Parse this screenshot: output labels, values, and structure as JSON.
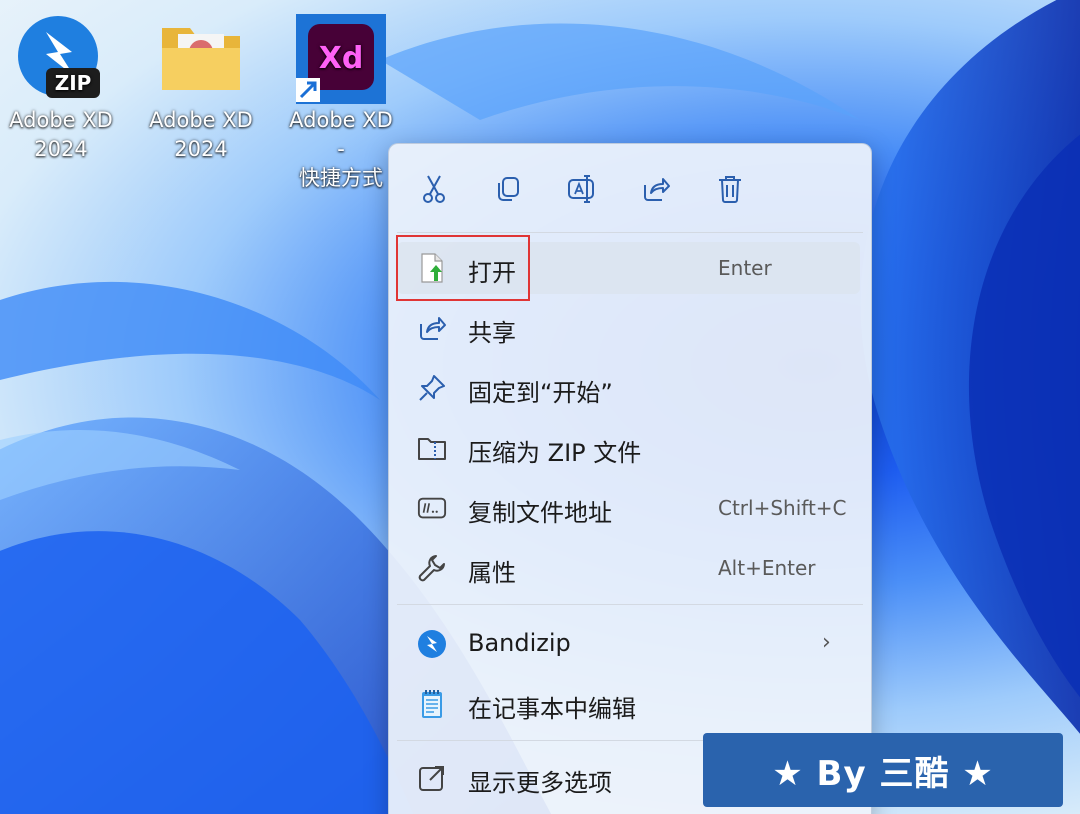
{
  "desktop": {
    "icons": [
      {
        "label_line1": "Adobe XD",
        "label_line2": "2024",
        "icon": "zip-archive-icon",
        "badge_text": "ZIP"
      },
      {
        "label_line1": "Adobe XD",
        "label_line2": "2024",
        "icon": "folder-icon"
      },
      {
        "label_line1": "Adobe XD -",
        "label_line2": "快捷方式",
        "icon": "adobe-xd-app-icon",
        "badge_text": "Xd"
      }
    ]
  },
  "context_menu": {
    "toolbar": [
      "cut-icon",
      "copy-icon",
      "rename-icon",
      "share-icon",
      "delete-icon"
    ],
    "items": [
      {
        "label": "打开",
        "shortcut": "Enter",
        "icon": "open-file-icon"
      },
      {
        "label": "共享",
        "shortcut": "",
        "icon": "share-icon"
      },
      {
        "label": "固定到“开始”",
        "shortcut": "",
        "icon": "pin-icon"
      },
      {
        "label": "压缩为 ZIP 文件",
        "shortcut": "",
        "icon": "zip-folder-icon"
      },
      {
        "label": "复制文件地址",
        "shortcut": "Ctrl+Shift+C",
        "icon": "copy-path-icon"
      },
      {
        "label": "属性",
        "shortcut": "Alt+Enter",
        "icon": "wrench-icon"
      },
      {
        "label": "Bandizip",
        "shortcut": "",
        "icon": "bandizip-icon",
        "submenu": "›"
      },
      {
        "label": "在记事本中编辑",
        "shortcut": "",
        "icon": "notepad-icon"
      },
      {
        "label": "显示更多选项",
        "shortcut": "",
        "icon": "more-options-icon"
      }
    ]
  },
  "watermark": {
    "text": "★ By 三酷 ★"
  },
  "colors": {
    "accent": "#2a63ad",
    "highlight_border": "#e03535",
    "xd_purple": "#470137",
    "xd_pink": "#ff61f6"
  }
}
